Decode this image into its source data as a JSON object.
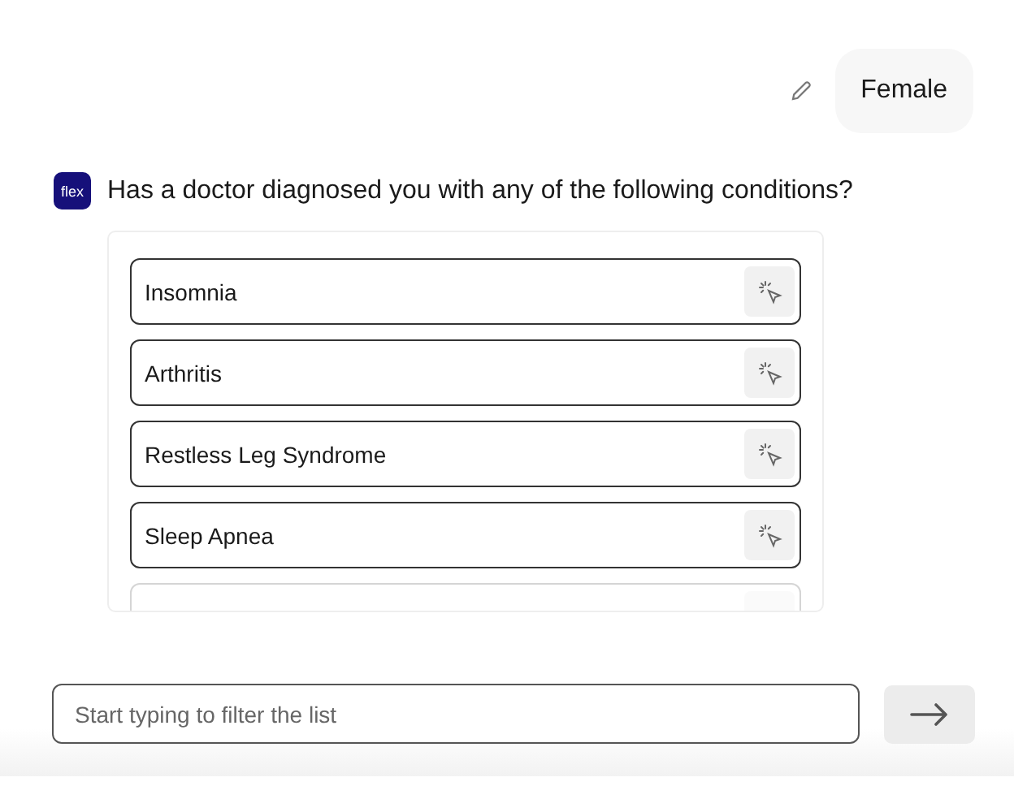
{
  "user_message": {
    "text": "Female"
  },
  "bot": {
    "logo": "flex",
    "question": "Has a doctor diagnosed you with any of the following conditions?"
  },
  "options": [
    {
      "label": "Insomnia"
    },
    {
      "label": "Arthritis"
    },
    {
      "label": "Restless Leg Syndrome"
    },
    {
      "label": "Sleep Apnea"
    }
  ],
  "more_options_below": true,
  "filter": {
    "placeholder": "Start typing to filter the list"
  }
}
